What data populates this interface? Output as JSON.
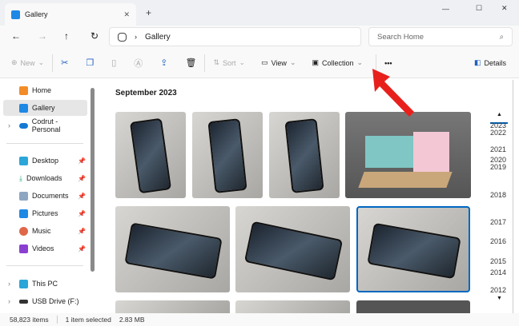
{
  "window": {
    "tab_title": "Gallery",
    "new_tab": "+",
    "minimize": "—",
    "maximize": "☐",
    "close": "✕"
  },
  "address": {
    "path": "Gallery",
    "search_placeholder": "Search Home"
  },
  "toolbar": {
    "new": "New",
    "sort": "Sort",
    "view": "View",
    "collection": "Collection",
    "more": "•••",
    "details": "Details"
  },
  "sidebar": {
    "items": [
      "Home",
      "Gallery",
      "Codrut - Personal",
      "Desktop",
      "Downloads",
      "Documents",
      "Pictures",
      "Music",
      "Videos",
      "This PC",
      "USB Drive (F:)"
    ]
  },
  "main": {
    "section_title": "September 2023"
  },
  "timeline": [
    "2023",
    "2022",
    "2021",
    "2020",
    "2019",
    "2018",
    "2017",
    "2016",
    "2015",
    "2014",
    "2012"
  ],
  "status": {
    "count": "58,823 items",
    "selected": "1 item selected",
    "size": "2.83 MB"
  },
  "colors": {
    "accent": "#0067c0",
    "arrow": "#e8201c"
  }
}
